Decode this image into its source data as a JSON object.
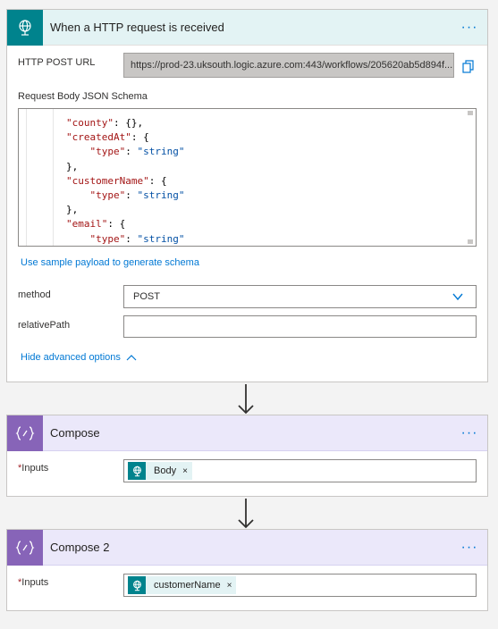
{
  "trigger": {
    "title": "When a HTTP request is received",
    "more_label": "···",
    "url_label": "HTTP POST URL",
    "url_value": "https://prod-23.uksouth.logic.azure.com:443/workflows/205620ab5d894f...",
    "schema_label": "Request Body JSON Schema",
    "schema_lines": [
      "        \"county\": {},",
      "        \"createdAt\": {",
      "            \"type\": \"string\"",
      "        },",
      "        \"customerName\": {",
      "            \"type\": \"string\"",
      "        },",
      "        \"email\": {",
      "            \"type\": \"string\""
    ],
    "sample_link": "Use sample payload to generate schema",
    "method_label": "method",
    "method_value": "POST",
    "relpath_label": "relativePath",
    "relpath_value": "",
    "advanced_link": "Hide advanced options"
  },
  "compose1": {
    "title": "Compose",
    "more_label": "···",
    "inputs_required": "*",
    "inputs_label": "Inputs",
    "token_label": "Body",
    "token_remove": "×"
  },
  "compose2": {
    "title": "Compose 2",
    "more_label": "···",
    "inputs_required": "*",
    "inputs_label": "Inputs",
    "token_label": "customerName",
    "token_remove": "×"
  },
  "colors": {
    "request_teal": "#00838d",
    "request_header_bg": "#e3f3f4",
    "compose_purple": "#8764b8",
    "compose_header_bg": "#ebe8fa",
    "link_blue": "#0078d4",
    "json_key_red": "#a31515",
    "json_string_blue": "#0451a5"
  },
  "icons": {
    "trigger": "globe-request-icon",
    "compose": "curly-braces-icon",
    "copy": "copy-icon",
    "dropdown": "chevron-down-icon",
    "collapse": "chevron-up-icon",
    "arrow": "arrow-down-icon"
  }
}
